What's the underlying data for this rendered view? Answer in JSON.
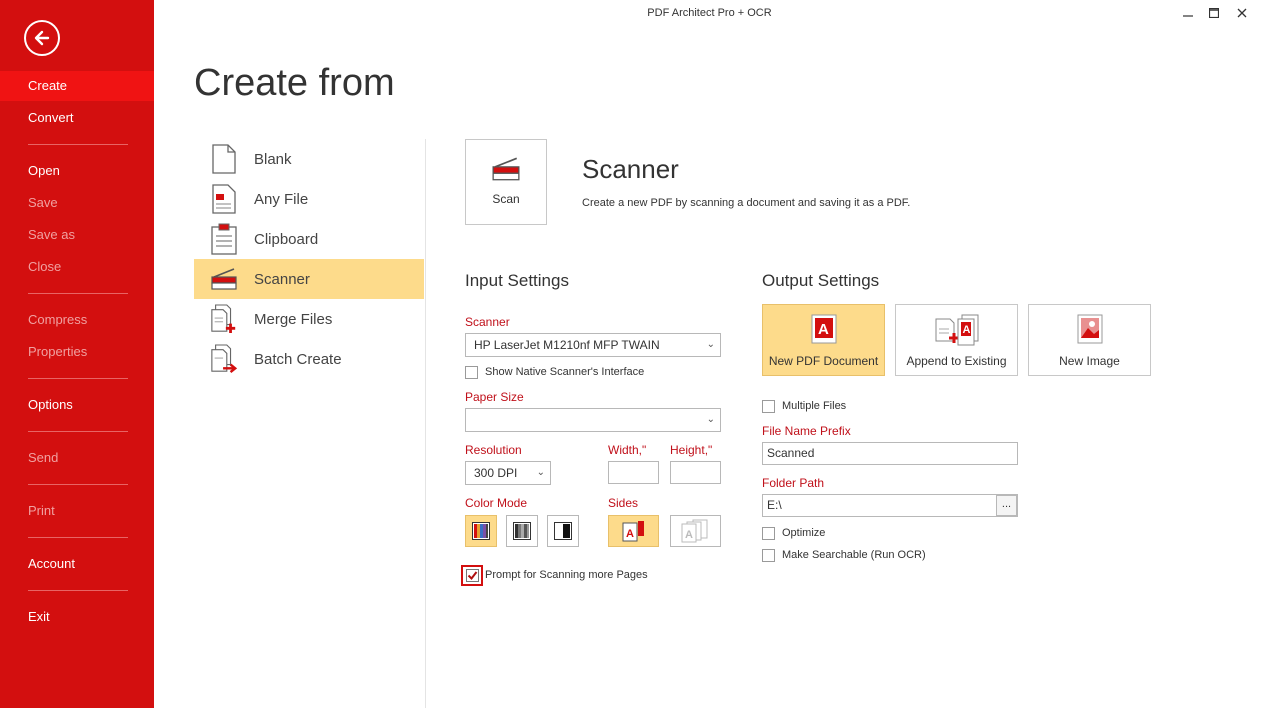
{
  "window": {
    "title": "PDF Architect Pro + OCR"
  },
  "sidebar": {
    "items": [
      {
        "label": "Create",
        "state": "active"
      },
      {
        "label": "Convert",
        "state": "normal"
      },
      {
        "label": "Open",
        "state": "normal"
      },
      {
        "label": "Save",
        "state": "disabled"
      },
      {
        "label": "Save as",
        "state": "disabled"
      },
      {
        "label": "Close",
        "state": "disabled"
      },
      {
        "label": "Compress",
        "state": "disabled"
      },
      {
        "label": "Properties",
        "state": "disabled"
      },
      {
        "label": "Options",
        "state": "normal"
      },
      {
        "label": "Send",
        "state": "disabled"
      },
      {
        "label": "Print",
        "state": "disabled"
      },
      {
        "label": "Account",
        "state": "normal"
      },
      {
        "label": "Exit",
        "state": "normal"
      }
    ]
  },
  "page": {
    "title": "Create from"
  },
  "create_list": {
    "items": [
      {
        "label": "Blank",
        "icon": "blank-page-icon"
      },
      {
        "label": "Any File",
        "icon": "any-file-icon"
      },
      {
        "label": "Clipboard",
        "icon": "clipboard-icon"
      },
      {
        "label": "Scanner",
        "icon": "scanner-icon",
        "selected": true
      },
      {
        "label": "Merge Files",
        "icon": "merge-files-icon"
      },
      {
        "label": "Batch Create",
        "icon": "batch-create-icon"
      }
    ]
  },
  "scanner_panel": {
    "scan_button": "Scan",
    "heading": "Scanner",
    "description": "Create a new PDF by scanning a document and saving it as a PDF."
  },
  "input_settings": {
    "title": "Input Settings",
    "scanner_label": "Scanner",
    "scanner_value": "HP LaserJet M1210nf MFP TWAIN",
    "show_native_label": "Show Native Scanner's Interface",
    "show_native_checked": false,
    "paper_size_label": "Paper Size",
    "paper_size_value": "",
    "resolution_label": "Resolution",
    "resolution_value": "300 DPI",
    "width_label": "Width,\"",
    "width_value": "",
    "height_label": "Height,\"",
    "height_value": "",
    "color_mode_label": "Color Mode",
    "color_modes": [
      "color",
      "grayscale",
      "black-white"
    ],
    "color_mode_selected": "color",
    "sides_label": "Sides",
    "sides_selected": "single",
    "prompt_label": "Prompt for Scanning more Pages",
    "prompt_checked": true
  },
  "output_settings": {
    "title": "Output Settings",
    "tiles": [
      {
        "label": "New PDF Document",
        "selected": true
      },
      {
        "label": "Append to Existing",
        "selected": false
      },
      {
        "label": "New Image",
        "selected": false
      }
    ],
    "multiple_files_label": "Multiple Files",
    "multiple_files_checked": false,
    "file_prefix_label": "File Name Prefix",
    "file_prefix_value": "Scanned",
    "folder_path_label": "Folder Path",
    "folder_path_value": "E:\\",
    "browse_label": "...",
    "optimize_label": "Optimize",
    "optimize_checked": false,
    "ocr_label": "Make Searchable (Run OCR)",
    "ocr_checked": false
  },
  "colors": {
    "sidebar": "#d30f0f",
    "sidebar_active": "#f01313",
    "accent_label": "#c0101a",
    "selection": "#fddb8b"
  }
}
